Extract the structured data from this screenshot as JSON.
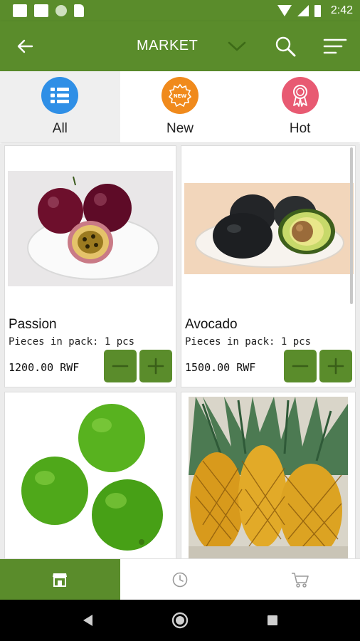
{
  "status_bar": {
    "time": "2:42"
  },
  "app_bar": {
    "title": "MARKET"
  },
  "tabs": [
    {
      "label": "All",
      "icon": "list-icon",
      "color": "#2f8fe6"
    },
    {
      "label": "New",
      "icon": "new-badge-icon",
      "color": "#f08a1c"
    },
    {
      "label": "Hot",
      "icon": "award-ribbon-icon",
      "color": "#e85a72"
    }
  ],
  "products": [
    {
      "name": "Passion",
      "pack": "Pieces in pack: 1 pcs",
      "price": "1200.00 RWF",
      "image": "passion-fruit"
    },
    {
      "name": "Avocado",
      "pack": "Pieces in pack: 1 pcs",
      "price": "1500.00 RWF",
      "image": "avocado"
    },
    {
      "image": "limes"
    },
    {
      "image": "pineapples"
    }
  ],
  "bottom_nav": [
    {
      "icon": "store-icon",
      "active": true
    },
    {
      "icon": "history-clock-icon",
      "active": false
    },
    {
      "icon": "cart-icon",
      "active": false
    }
  ],
  "colors": {
    "primary": "#5a8c2b",
    "tab_all": "#2f8fe6",
    "tab_new": "#f08a1c",
    "tab_hot": "#e85a72"
  }
}
